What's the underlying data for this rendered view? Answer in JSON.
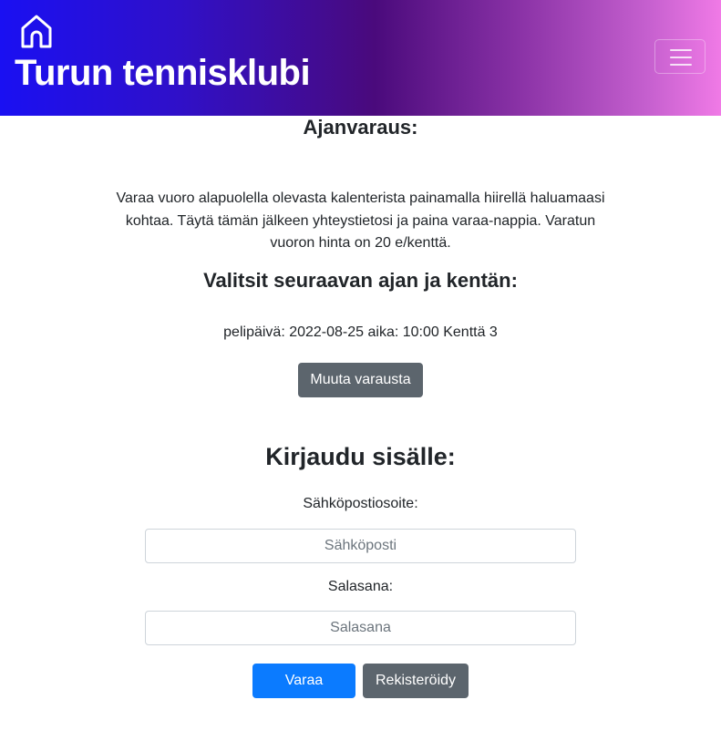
{
  "header": {
    "brand": "Turun tennisklubi",
    "home_icon": "home-icon",
    "menu_icon": "hamburger-menu-icon",
    "gradient_colors": [
      "#1a10f2",
      "#4a0a7c",
      "#f07ae6"
    ]
  },
  "booking": {
    "title": "Ajanvaraus:",
    "intro": "Varaa vuoro alapuolella olevasta kalenterista painamalla hiirellä haluamaasi kohtaa. Täytä tämän jälkeen yhteystietosi ja paina varaa-nappia. Varatun vuoron hinta on 20 e/kenttä.",
    "selected_title": "Valitsit seuraavan ajan ja kentän:",
    "selection": "pelipäivä: 2022-08-25 aika: 10:00 Kenttä 3",
    "change_button": "Muuta varausta"
  },
  "login": {
    "title": "Kirjaudu sisälle:",
    "email_label": "Sähköpostiosoite:",
    "email_placeholder": "Sähköposti",
    "email_value": "",
    "password_label": "Salasana:",
    "password_placeholder": "Salasana",
    "password_value": "",
    "submit_button": "Varaa",
    "register_button": "Rekisteröidy"
  },
  "colors": {
    "primary": "#0b7bff",
    "secondary": "#5c656d",
    "text": "#212529"
  }
}
